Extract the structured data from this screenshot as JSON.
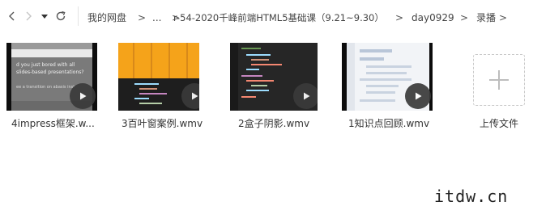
{
  "breadcrumb": {
    "items": [
      "我的网盘",
      "...",
      "r-54-2020千峰前端HTML5基础课（9.21~9.30）",
      "day0929",
      "录播"
    ],
    "separator": ">"
  },
  "files": [
    {
      "name": "4impress框架.w...",
      "thumb_caption_top": "d you just bored with all",
      "thumb_caption_mid": "slides-based presentations?",
      "thumb_caption_bottom": "ee a transition on abasis inst"
    },
    {
      "name": "3百叶窗案例.wmv"
    },
    {
      "name": "2盒子阴影.wmv"
    },
    {
      "name": "1知识点回顾.wmv"
    }
  ],
  "upload": {
    "label": "上传文件"
  },
  "watermark": "itdw.cn",
  "colors": {
    "accent_orange": "#f5a31a",
    "editor_bg": "#1e1e1e",
    "play_button": "#3a3a3a"
  },
  "icons": [
    "arrow-left-icon",
    "arrow-right-icon",
    "chevron-down-icon",
    "refresh-icon",
    "play-icon",
    "plus-icon"
  ]
}
